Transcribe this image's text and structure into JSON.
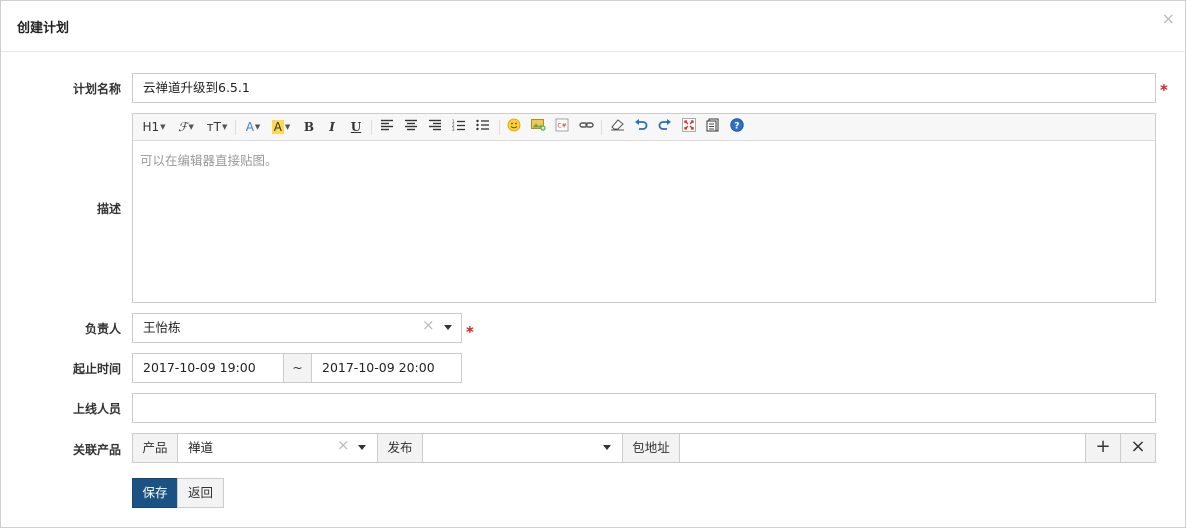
{
  "dialog": {
    "title": "创建计划",
    "close_glyph": "×"
  },
  "form": {
    "name": {
      "label": "计划名称",
      "value": "云禅道升级到6.5.1",
      "required": "*"
    },
    "desc": {
      "label": "描述",
      "placeholder": "可以在编辑器直接贴图。",
      "toolbar": {
        "heading": "H1",
        "font_family": "ℱ",
        "font_size": "ᴛT",
        "font_color": "A",
        "highlight": "A",
        "bold": "B",
        "italic": "I",
        "underline": "U"
      }
    },
    "owner": {
      "label": "负责人",
      "value": "王怡栋",
      "required": "*"
    },
    "time": {
      "label": "起止时间",
      "start": "2017-10-09 19:00",
      "separator": "~",
      "end": "2017-10-09 20:00"
    },
    "online_staff": {
      "label": "上线人员",
      "value": ""
    },
    "product": {
      "label": "关联产品",
      "product_addon": "产品",
      "product_value": "禅道",
      "release_addon": "发布",
      "release_value": "",
      "package_addon": "包地址",
      "package_value": "",
      "add_glyph": "+",
      "remove_glyph": "×"
    },
    "buttons": {
      "save": "保存",
      "back": "返回"
    }
  },
  "colors": {
    "primary": "#1a5284",
    "required": "#d9201f",
    "border": "#cccccc"
  }
}
